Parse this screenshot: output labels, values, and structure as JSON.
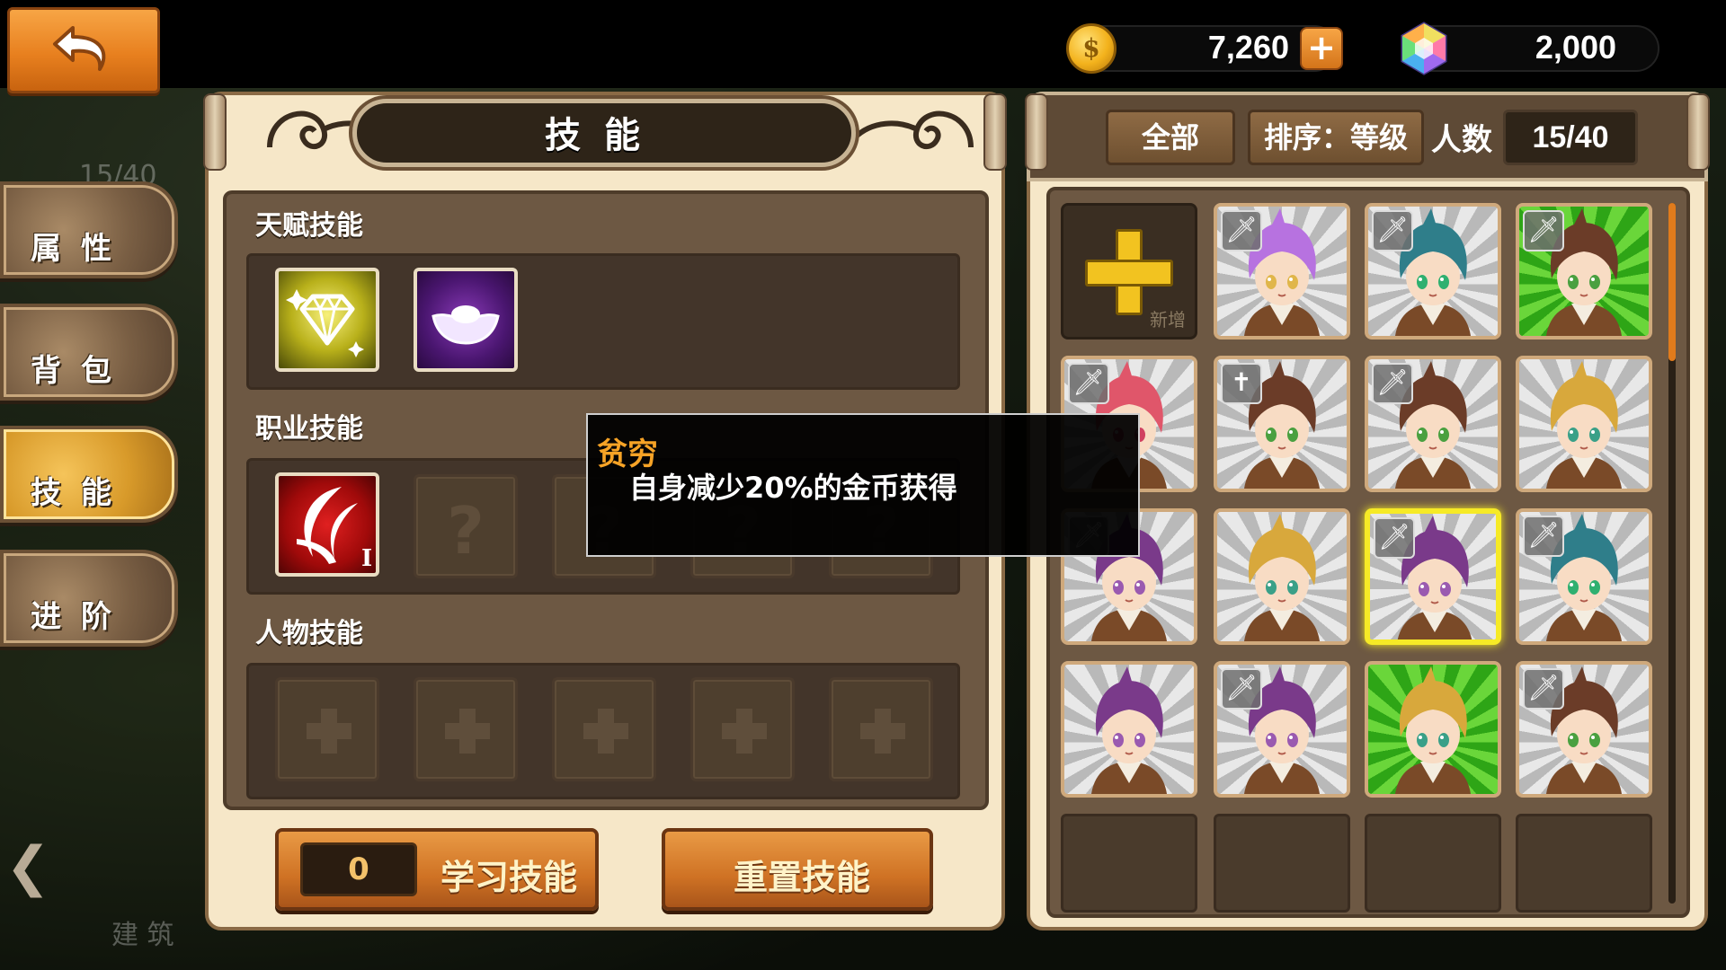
{
  "currency": {
    "coins": "7,260",
    "coin_symbol": "$",
    "gems": "2,000",
    "add_label": "+"
  },
  "side_tabs": [
    {
      "label": "属性",
      "active": false
    },
    {
      "label": "背包",
      "active": false
    },
    {
      "label": "技能",
      "active": true
    },
    {
      "label": "进阶",
      "active": false
    }
  ],
  "background_text": {
    "top_count": "15/40",
    "building": "建 筑"
  },
  "skill_panel": {
    "title": "技能",
    "sections": {
      "talent": "天赋技能",
      "class": "职业技能",
      "character": "人物技能"
    },
    "talent_icons": [
      "diamond-skill-icon",
      "silver-ingot-skill-icon"
    ],
    "class_icons": [
      "claw-slash-skill-icon"
    ],
    "class_icon_level": "I",
    "locked_mark": "?",
    "points": "0",
    "learn_label": "学习技能",
    "reset_label": "重置技能"
  },
  "tooltip": {
    "title": "贫穷",
    "body": "自身减少20%的金币获得"
  },
  "roster": {
    "filter_all": "全部",
    "sort_label": "排序：等级",
    "count_label": "人数",
    "count_value": "15/40",
    "add_label": "新增",
    "heroes": [
      {
        "hair": "#b772e0",
        "eye": "#e0b64a",
        "bg": "gray",
        "badge": "sword"
      },
      {
        "hair": "#2f7e8a",
        "eye": "#2fb070",
        "bg": "gray",
        "badge": "sword"
      },
      {
        "hair": "#6b3c28",
        "eye": "#4aa040",
        "bg": "green",
        "badge": "sword"
      },
      {
        "hair": "#e0566a",
        "eye": "#d04060",
        "bg": "gray",
        "badge": "sword"
      },
      {
        "hair": "#6b3c28",
        "eye": "#4aa040",
        "bg": "gray",
        "badge": "cross"
      },
      {
        "hair": "#6b3c28",
        "eye": "#4aa040",
        "bg": "gray",
        "badge": "sword"
      },
      {
        "hair": "#d8a83c",
        "eye": "#3aa088",
        "bg": "gray",
        "badge": ""
      },
      {
        "hair": "#7a3a8a",
        "eye": "#9a5ab0",
        "bg": "gray",
        "badge": "sword"
      },
      {
        "hair": "#d8a83c",
        "eye": "#3aa088",
        "bg": "gray",
        "badge": ""
      },
      {
        "hair": "#7a3a8a",
        "eye": "#9a5ab0",
        "bg": "gray",
        "badge": "sword",
        "selected": true
      },
      {
        "hair": "#2f7e8a",
        "eye": "#2fb070",
        "bg": "gray",
        "badge": "sword"
      },
      {
        "hair": "#7a3a8a",
        "eye": "#9a5ab0",
        "bg": "gray",
        "badge": ""
      },
      {
        "hair": "#7a3a8a",
        "eye": "#9a5ab0",
        "bg": "gray",
        "badge": "sword"
      },
      {
        "hair": "#d8a83c",
        "eye": "#3aa088",
        "bg": "green",
        "badge": ""
      },
      {
        "hair": "#6b3c28",
        "eye": "#4aa040",
        "bg": "gray",
        "badge": "sword"
      }
    ]
  }
}
